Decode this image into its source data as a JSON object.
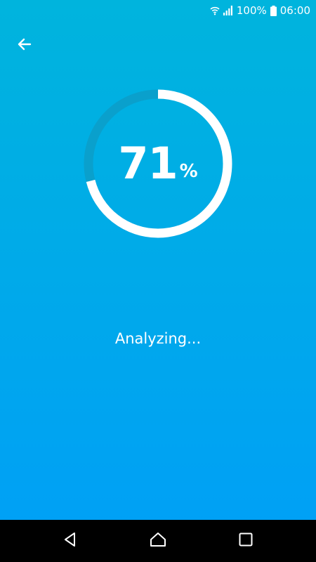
{
  "status_bar": {
    "battery_text": "100%",
    "time": "06:00",
    "icons": [
      "wifi-icon",
      "signal-icon",
      "battery-icon"
    ]
  },
  "header": {
    "back_icon": "arrow-left-icon"
  },
  "progress": {
    "value": "71",
    "unit": "%",
    "fraction": 0.71
  },
  "status": {
    "label": "Analyzing..."
  },
  "nav_bar": {
    "icons": [
      "back-triangle-icon",
      "home-icon",
      "recents-square-icon"
    ]
  },
  "colors": {
    "gradient_top": "#00b4dd",
    "gradient_bottom": "#009ff7",
    "ring_track": "#0aa0cc",
    "ring_fill": "#ffffff",
    "nav_background": "#000000"
  }
}
